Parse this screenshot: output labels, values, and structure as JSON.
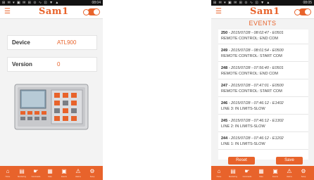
{
  "status_bar": {
    "icons": "⊞ ✉ ▾ ▣ ✉ ⊞ ⊙ ∿ ⊡ ▼ ▲",
    "time": "08:04"
  },
  "status_bar_right": {
    "time": "08:05"
  },
  "app": {
    "logo_text": "Sam1"
  },
  "left_screen": {
    "device": {
      "label": "Device",
      "value": "ATL900"
    },
    "version": {
      "label": "Version",
      "value": "0"
    }
  },
  "right_screen": {
    "title": "EVENTS",
    "events": [
      {
        "id": "250",
        "meta": " - 2015/07/28 - 08:02:47 - E0501",
        "desc": "REMOTE CONTROL: END COM"
      },
      {
        "id": "249",
        "meta": " - 2015/07/28 - 08:01:54 - E0500",
        "desc": "REMOTE CONTROL: START COM"
      },
      {
        "id": "248",
        "meta": " - 2015/07/28 - 07:56:40 - E0501",
        "desc": "REMOTE CONTROL: END COM"
      },
      {
        "id": "247",
        "meta": " - 2015/07/28 - 07:47:01 - E0500",
        "desc": "REMOTE CONTROL: START COM"
      },
      {
        "id": "246",
        "meta": " - 2015/07/28 - 07:46:12 - E1402",
        "desc": "LINE 3: IN LIMITS-SLOW"
      },
      {
        "id": "245",
        "meta": " - 2015/07/28 - 07:46:12 - E1302",
        "desc": "LINE 2: IN LIMITS-SLOW"
      },
      {
        "id": "244",
        "meta": " - 2015/07/28 - 07:46:12 - E1202",
        "desc": "LINE 1: IN LIMITS-SLOW"
      }
    ],
    "buttons": {
      "reset": "Reset",
      "save": "Save"
    }
  },
  "bottom_nav": {
    "items": [
      {
        "icon": "home-icon",
        "label": "Home"
      },
      {
        "icon": "monitoring-icon",
        "label": "Monitoring"
      },
      {
        "icon": "commands-icon",
        "label": "Commands"
      },
      {
        "icon": "data-icon",
        "label": "Data"
      },
      {
        "icon": "events-icon",
        "label": "Events"
      },
      {
        "icon": "alarms-icon",
        "label": "Alarms"
      },
      {
        "icon": "setup-icon",
        "label": "Setup"
      }
    ]
  },
  "colors": {
    "accent": "#e8632b",
    "background": "#f3f3f3",
    "statusbar": "#121212"
  }
}
